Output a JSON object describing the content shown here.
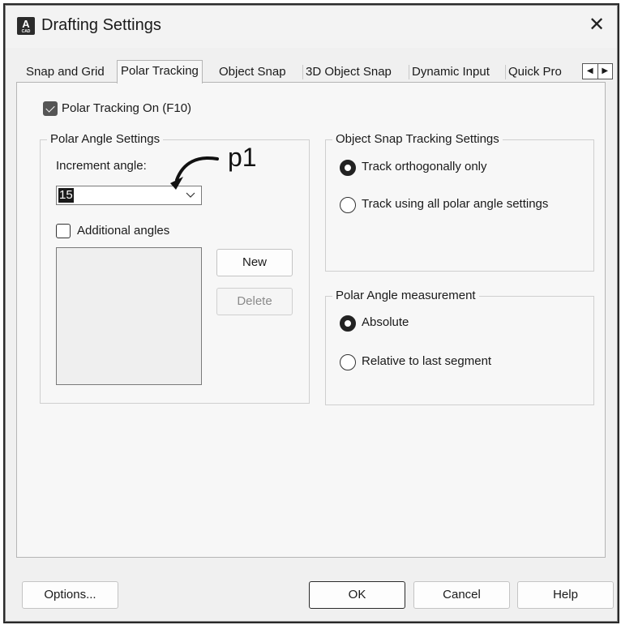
{
  "window": {
    "title": "Drafting Settings"
  },
  "tabs": [
    {
      "label": "Snap and Grid"
    },
    {
      "label": "Polar Tracking",
      "active": true
    },
    {
      "label": "Object Snap"
    },
    {
      "label": "3D Object Snap"
    },
    {
      "label": "Dynamic Input"
    },
    {
      "label": "Quick Pro"
    }
  ],
  "polar": {
    "on_label": "Polar Tracking On (F10)",
    "on_checked": true,
    "angle_group": {
      "title": "Polar Angle Settings",
      "increment_label": "Increment angle:",
      "increment_value": "15",
      "additional_label": "Additional angles",
      "additional_checked": false,
      "new_button": "New",
      "delete_button": "Delete"
    },
    "snap_group": {
      "title": "Object Snap Tracking Settings",
      "options": [
        {
          "label": "Track orthogonally only",
          "selected": true
        },
        {
          "label": "Track using all polar angle settings",
          "selected": false
        }
      ]
    },
    "measure_group": {
      "title": "Polar Angle measurement",
      "options": [
        {
          "label": "Absolute",
          "selected": true
        },
        {
          "label": "Relative to last segment",
          "selected": false
        }
      ]
    }
  },
  "annotation": {
    "label": "p1"
  },
  "footer": {
    "options": "Options...",
    "ok": "OK",
    "cancel": "Cancel",
    "help": "Help"
  },
  "icons": {
    "app": "autocad-app-icon",
    "app_letter": "A",
    "app_sub": "CAD",
    "close": "close-icon",
    "tab_left": "◀",
    "tab_right": "▶"
  }
}
